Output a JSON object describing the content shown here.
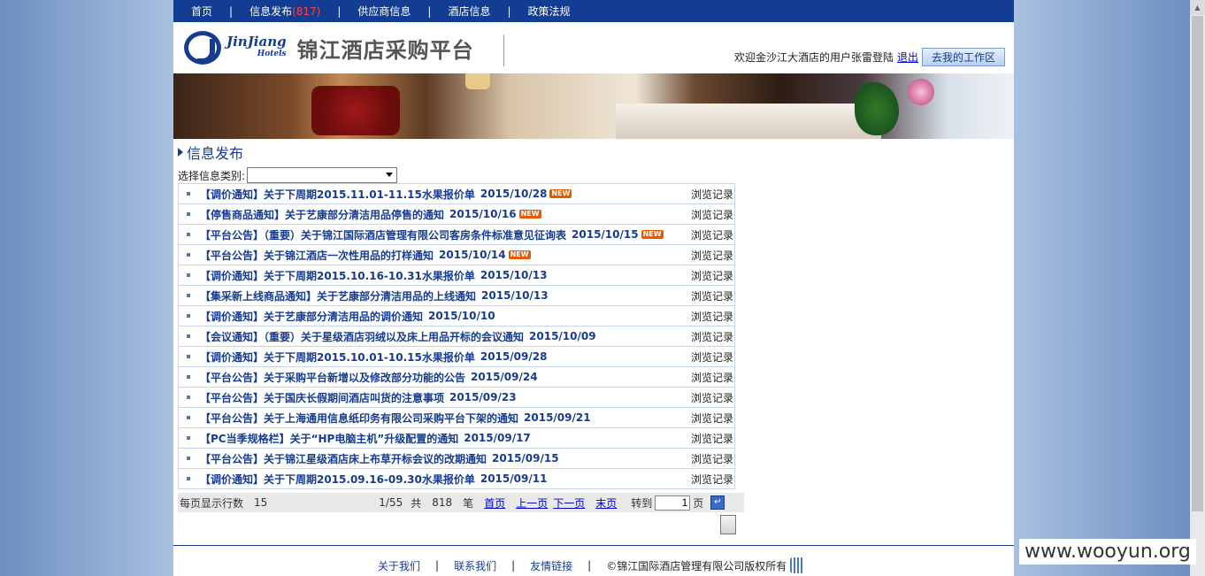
{
  "nav": {
    "items": [
      "首页",
      "信息发布",
      "供应商信息",
      "酒店信息",
      "政策法规"
    ],
    "info_badge": "(817)",
    "separator": "|"
  },
  "header": {
    "logo_en": "JinJiang",
    "logo_en_sub": "Hotels",
    "logo_cn": "锦江酒店采购平台",
    "welcome_text": "欢迎金沙江大酒店的用户张雷登陆",
    "logout_label": "退出",
    "workspace_button": "去我的工作区"
  },
  "section": {
    "title": "信息发布",
    "filter_label": "选择信息类别:",
    "filter_value": ""
  },
  "list": [
    {
      "title": "【调价通知】关于下周期2015.11.01-11.15水果报价单",
      "date": "2015/10/28",
      "new": true,
      "browse": "浏览记录"
    },
    {
      "title": "【停售商品通知】关于艺康部分清洁用品停售的通知",
      "date": "2015/10/16",
      "new": true,
      "browse": "浏览记录"
    },
    {
      "title": "【平台公告】（重要）关于锦江国际酒店管理有限公司客房条件标准意见征询表",
      "date": "2015/10/15",
      "new": true,
      "browse": "浏览记录"
    },
    {
      "title": "【平台公告】关于锦江酒店一次性用品的打样通知",
      "date": "2015/10/14",
      "new": true,
      "browse": "浏览记录"
    },
    {
      "title": "【调价通知】关于下周期2015.10.16-10.31水果报价单",
      "date": "2015/10/13",
      "new": false,
      "browse": "浏览记录"
    },
    {
      "title": "【集采新上线商品通知】关于艺康部分清洁用品的上线通知",
      "date": "2015/10/13",
      "new": false,
      "browse": "浏览记录"
    },
    {
      "title": "【调价通知】关于艺康部分清洁用品的调价通知",
      "date": "2015/10/10",
      "new": false,
      "browse": "浏览记录"
    },
    {
      "title": "【会议通知】（重要）关于星级酒店羽绒以及床上用品开标的会议通知",
      "date": "2015/10/09",
      "new": false,
      "browse": "浏览记录"
    },
    {
      "title": "【调价通知】关于下周期2015.10.01-10.15水果报价单",
      "date": "2015/09/28",
      "new": false,
      "browse": "浏览记录"
    },
    {
      "title": "【平台公告】关于采购平台新增以及修改部分功能的公告",
      "date": "2015/09/24",
      "new": false,
      "browse": "浏览记录"
    },
    {
      "title": "【平台公告】关于国庆长假期间酒店叫货的注意事项",
      "date": "2015/09/23",
      "new": false,
      "browse": "浏览记录"
    },
    {
      "title": "【平台公告】关于上海通用信息纸印务有限公司采购平台下架的通知",
      "date": "2015/09/21",
      "new": false,
      "browse": "浏览记录"
    },
    {
      "title": "【PC当季规格栏】关于“HP电脑主机”升级配置的通知",
      "date": "2015/09/17",
      "new": false,
      "browse": "浏览记录"
    },
    {
      "title": "【平台公告】关于锦江星级酒店床上布草开标会议的改期通知",
      "date": "2015/09/15",
      "new": false,
      "browse": "浏览记录"
    },
    {
      "title": "【调价通知】关于下周期2015.09.16-09.30水果报价单",
      "date": "2015/09/11",
      "new": false,
      "browse": "浏览记录"
    }
  ],
  "new_label": "NEW",
  "pager": {
    "per_page_label": "每页显示行数",
    "per_page": "15",
    "position": "1/55",
    "total_prefix": "共",
    "total": "818",
    "total_suffix": "笔",
    "first": "首页",
    "prev": "上一页",
    "next": "下一页",
    "last": "末页",
    "goto_label": "转到",
    "goto_value": "1",
    "page_suffix": "页"
  },
  "footer": {
    "about": "关于我们",
    "contact": "联系我们",
    "links": "友情链接",
    "separator": "|",
    "copyright": "©锦江国际酒店管理有限公司版权所有"
  },
  "watermark": "www.wooyun.org"
}
